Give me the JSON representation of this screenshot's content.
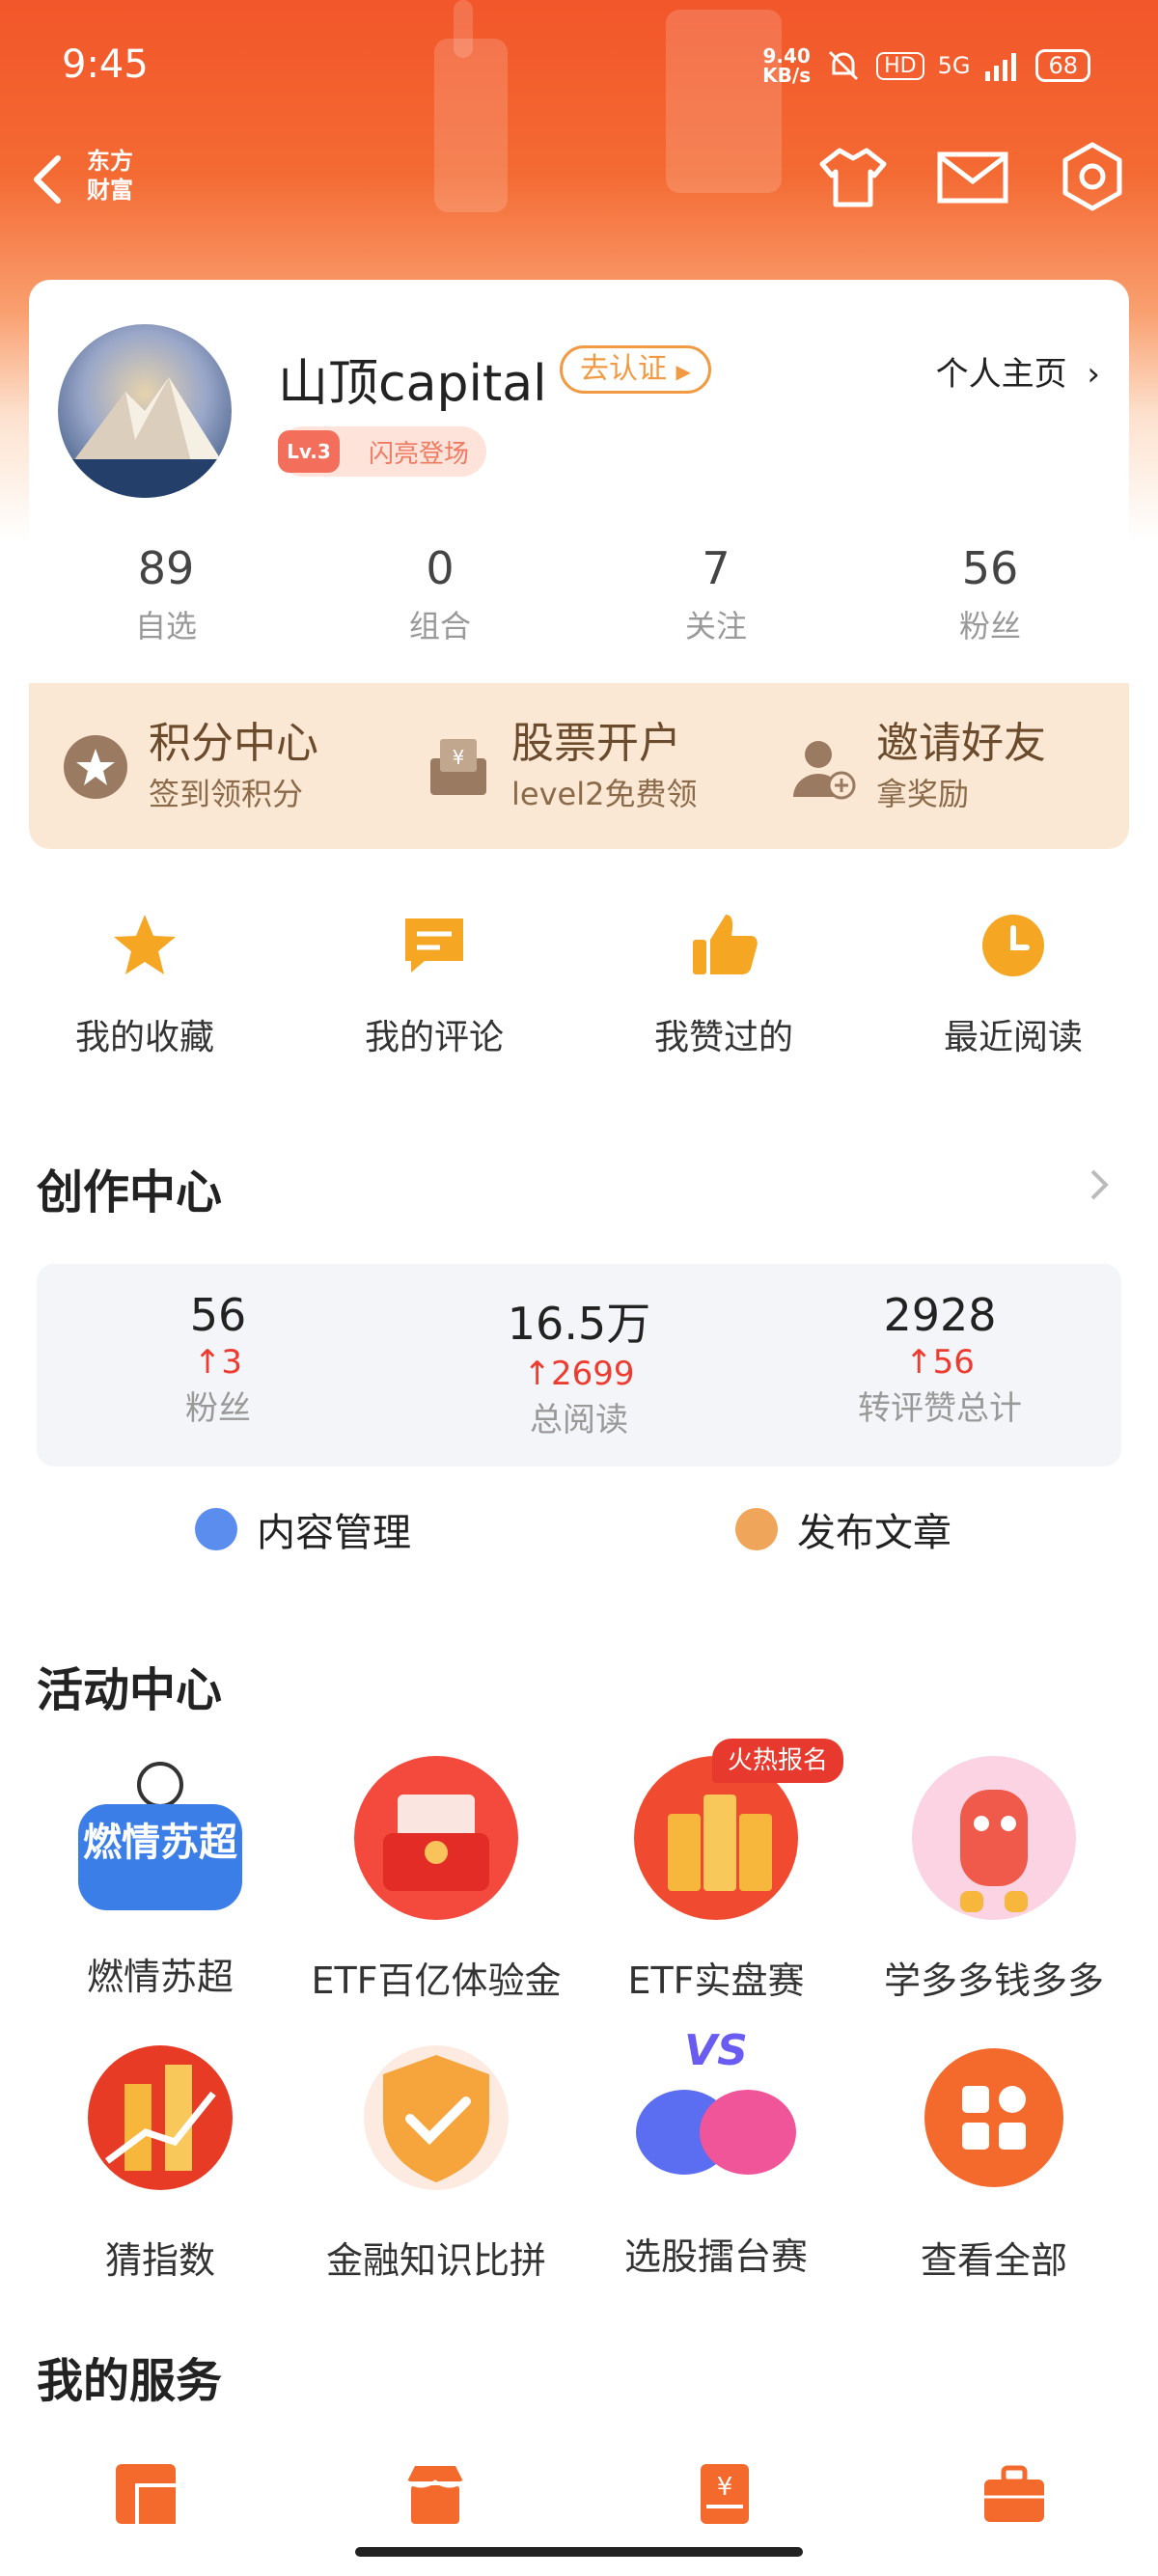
{
  "status_bar": {
    "time": "9:45",
    "net_speed_value": "9.40",
    "net_speed_unit": "KB/s",
    "hd": "HD",
    "signal": "5G",
    "battery": "68"
  },
  "nav": {
    "brand_line1": "东方",
    "brand_line2": "财富"
  },
  "profile": {
    "username": "山顶capital",
    "certify_label": "去认证",
    "level_badge": "Lv.3",
    "level_title": "闪亮登场",
    "homepage_link": "个人主页",
    "stats": [
      {
        "value": "89",
        "label": "自选"
      },
      {
        "value": "0",
        "label": "组合"
      },
      {
        "value": "7",
        "label": "关注"
      },
      {
        "value": "56",
        "label": "粉丝"
      }
    ]
  },
  "promo": [
    {
      "title": "积分中心",
      "subtitle": "签到领积分",
      "icon": "star-coin-icon"
    },
    {
      "title": "股票开户",
      "subtitle": "level2免费领",
      "icon": "yen-box-icon"
    },
    {
      "title": "邀请好友",
      "subtitle": "拿奖励",
      "icon": "add-user-icon"
    }
  ],
  "quick_links": [
    {
      "label": "我的收藏",
      "icon": "star-icon"
    },
    {
      "label": "我的评论",
      "icon": "comment-icon"
    },
    {
      "label": "我赞过的",
      "icon": "thumbs-up-icon"
    },
    {
      "label": "最近阅读",
      "icon": "clock-icon"
    }
  ],
  "creator_center": {
    "title": "创作中心",
    "stats": [
      {
        "value": "56",
        "delta": "3",
        "label": "粉丝"
      },
      {
        "value": "16.5万",
        "delta": "2699",
        "label": "总阅读"
      },
      {
        "value": "2928",
        "delta": "56",
        "label": "转评赞总计"
      }
    ],
    "actions": [
      {
        "label": "内容管理",
        "icon": "content-manage-icon"
      },
      {
        "label": "发布文章",
        "icon": "publish-article-icon"
      }
    ]
  },
  "activity_center": {
    "title": "活动中心",
    "hot_tag": "火热报名",
    "items": [
      {
        "label": "燃情苏超",
        "icon": "soccer-league-icon",
        "icon_text": "燃情苏超"
      },
      {
        "label": "ETF百亿体验金",
        "icon": "red-envelope-icon"
      },
      {
        "label": "ETF实盘赛",
        "icon": "gold-bars-icon"
      },
      {
        "label": "学多多钱多多",
        "icon": "mascot-icon"
      },
      {
        "label": "猜指数",
        "icon": "index-chart-icon"
      },
      {
        "label": "金融知识比拼",
        "icon": "shield-check-icon"
      },
      {
        "label": "选股擂台赛",
        "icon": "boxing-gloves-icon",
        "icon_text": "VS"
      },
      {
        "label": "查看全部",
        "icon": "grid-all-icon"
      }
    ]
  },
  "my_services": {
    "title": "我的服务"
  },
  "colors": {
    "brand": "#f2562a",
    "accent": "#f29a42",
    "up": "#ee3b2f"
  }
}
